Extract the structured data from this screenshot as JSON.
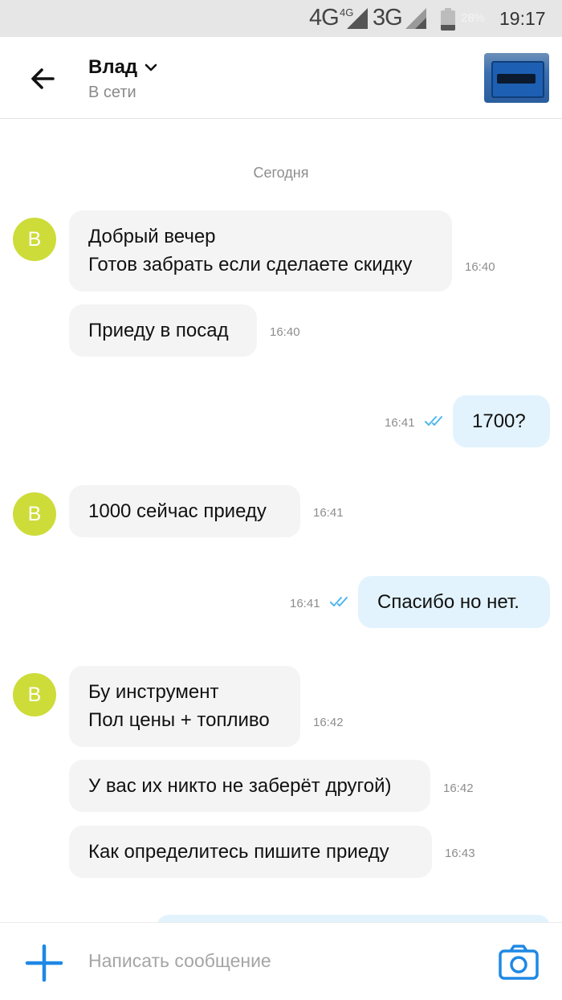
{
  "status_bar": {
    "net1": "4G",
    "net1_sup": "4G",
    "net2": "3G",
    "battery_pct": "28%",
    "battery_level": 0.28,
    "time": "19:17"
  },
  "header": {
    "contact_name": "Влад",
    "contact_status": "В сети"
  },
  "chat": {
    "day_label": "Сегодня",
    "avatar_letter": "В",
    "messages": [
      {
        "dir": "in",
        "lines": [
          "Добрый вечер",
          "Готов забрать если сделаете скидку"
        ],
        "time": "16:40"
      },
      {
        "dir": "in",
        "lines": [
          "Приеду в посад"
        ],
        "time": "16:40"
      },
      {
        "dir": "out",
        "lines": [
          "1700?"
        ],
        "time": "16:41"
      },
      {
        "dir": "in",
        "lines": [
          "1000 сейчас приеду"
        ],
        "time": "16:41"
      },
      {
        "dir": "out",
        "lines": [
          "Спасибо но нет."
        ],
        "time": "16:41"
      },
      {
        "dir": "in",
        "lines": [
          "Бу инструмент",
          "Пол цены + топливо"
        ],
        "time": "16:42"
      },
      {
        "dir": "in",
        "lines": [
          "У вас их никто не заберёт другой)"
        ],
        "time": "16:42"
      },
      {
        "dir": "in",
        "lines": [
          "Как определитесь пишите приеду"
        ],
        "time": "16:43"
      }
    ]
  },
  "composer": {
    "placeholder": "Написать сообщение"
  },
  "colors": {
    "accent": "#1e88e5",
    "avatar_bg": "#cddc39",
    "incoming_bubble": "#f4f4f4",
    "outgoing_bubble": "#e2f3fd",
    "read_ticks": "#4fb7ee"
  },
  "icons": {
    "back": "back-arrow-icon",
    "dropdown": "chevron-down-icon",
    "attach": "plus-icon",
    "camera": "camera-icon",
    "read": "double-check-icon"
  }
}
